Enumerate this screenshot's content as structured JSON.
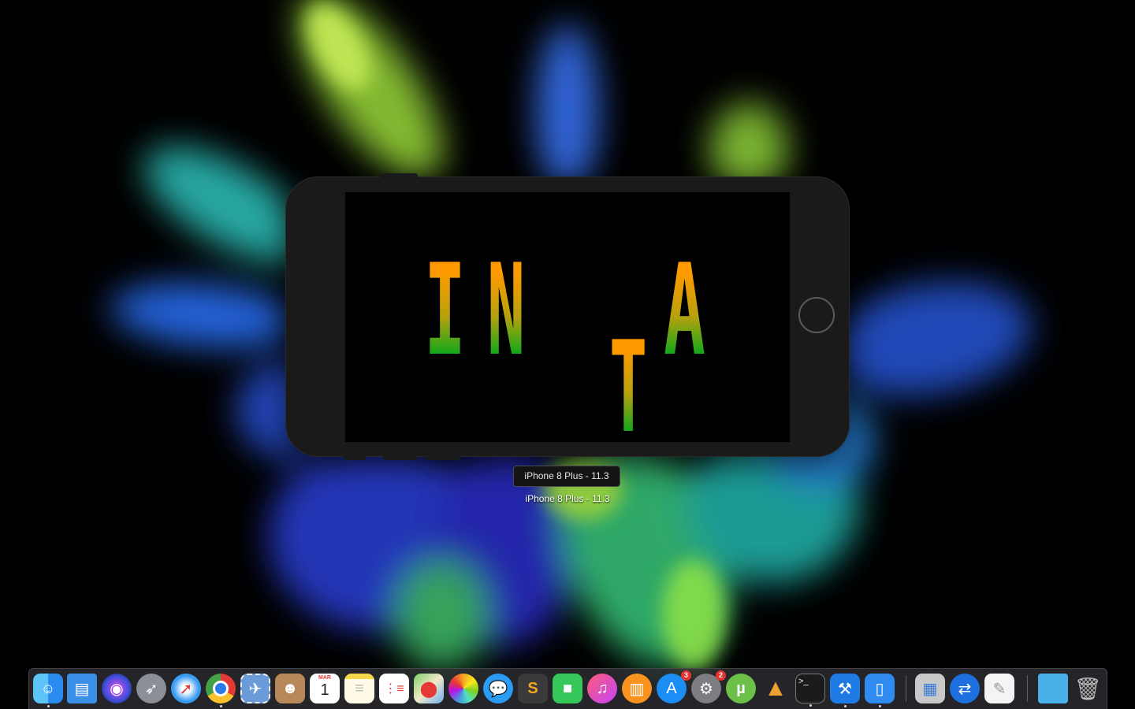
{
  "simulator": {
    "device_tooltip": "iPhone 8 Plus - 11.3",
    "device_caption": "iPhone 8 Plus - 11.3",
    "screen_glyphs": [
      "I",
      "N",
      "T",
      "A"
    ]
  },
  "dock": {
    "apps": [
      {
        "name": "Finder",
        "icon": "finder-icon",
        "running": true
      },
      {
        "name": "Files",
        "icon": "files-icon",
        "running": false
      },
      {
        "name": "Siri",
        "icon": "siri-icon",
        "running": false
      },
      {
        "name": "Launchpad",
        "icon": "launchpad-icon",
        "running": false
      },
      {
        "name": "Safari",
        "icon": "safari-icon",
        "running": false
      },
      {
        "name": "Chrome",
        "icon": "chrome-icon",
        "running": true
      },
      {
        "name": "Mail",
        "icon": "mail-stamp-icon",
        "running": false
      },
      {
        "name": "Contacts",
        "icon": "contacts-icon",
        "running": false
      },
      {
        "name": "Calendar",
        "icon": "calendar-icon",
        "running": false,
        "month": "MAR",
        "day": "1"
      },
      {
        "name": "Notes",
        "icon": "notes-icon",
        "running": false
      },
      {
        "name": "Reminders",
        "icon": "reminders-icon",
        "running": false
      },
      {
        "name": "Maps",
        "icon": "maps-icon",
        "running": false
      },
      {
        "name": "Photos",
        "icon": "photos-icon",
        "running": false
      },
      {
        "name": "Messages",
        "icon": "messages-icon",
        "running": false
      },
      {
        "name": "Sublime Text",
        "icon": "sublime-icon",
        "running": false
      },
      {
        "name": "FaceTime",
        "icon": "facetime-icon",
        "running": false
      },
      {
        "name": "iTunes",
        "icon": "itunes-icon",
        "running": false
      },
      {
        "name": "iBooks",
        "icon": "ibooks-icon",
        "running": false
      },
      {
        "name": "App Store",
        "icon": "app-store-icon",
        "running": false,
        "badge": "3"
      },
      {
        "name": "System Preferences",
        "icon": "system-preferences-icon",
        "running": false,
        "badge": "2"
      },
      {
        "name": "uTorrent",
        "icon": "utorrent-icon",
        "running": false
      },
      {
        "name": "Instruments",
        "icon": "instruments-icon",
        "running": false
      },
      {
        "name": "Terminal",
        "icon": "terminal-icon",
        "running": true
      },
      {
        "name": "Xcode",
        "icon": "xcode-icon",
        "running": true
      },
      {
        "name": "Simulator",
        "icon": "simulator-icon",
        "running": true
      },
      {
        "name": "Preview",
        "icon": "preview-icon",
        "running": false
      },
      {
        "name": "TeamViewer",
        "icon": "teamviewer-icon",
        "running": false
      },
      {
        "name": "TextEdit",
        "icon": "textedit-icon",
        "running": false
      },
      {
        "name": "Downloads",
        "icon": "folder-icon",
        "running": false
      },
      {
        "name": "Trash",
        "icon": "trash-icon",
        "running": false
      }
    ]
  }
}
